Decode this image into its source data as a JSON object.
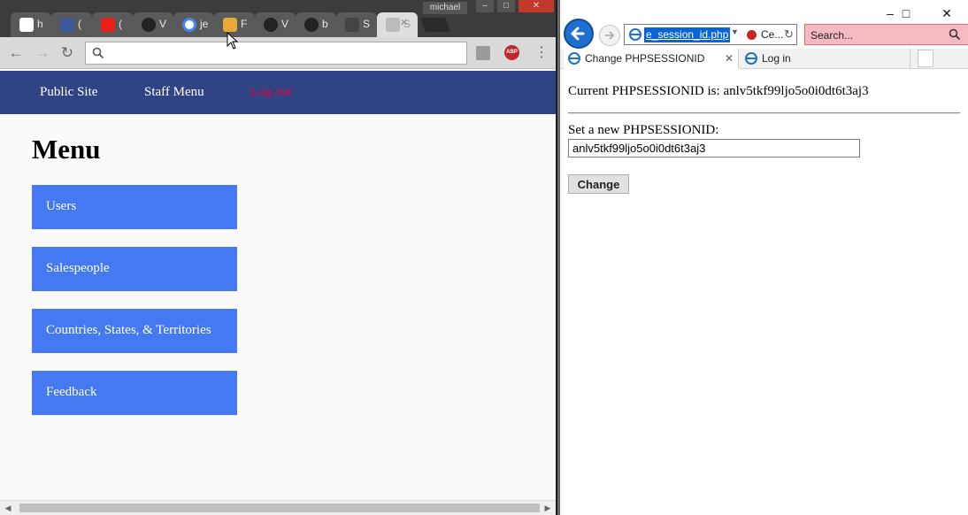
{
  "chrome": {
    "tabs": [
      {
        "title": "h",
        "icon": "c-logo-icon",
        "color": "#ffffff"
      },
      {
        "title": "(",
        "icon": "facebook-icon",
        "color": "#3b5998"
      },
      {
        "title": "(",
        "icon": "youtube-icon",
        "color": "#e62117"
      },
      {
        "title": "V",
        "icon": "github-icon",
        "color": "#222222"
      },
      {
        "title": "je",
        "icon": "google-icon",
        "color": "#ffffff"
      },
      {
        "title": "F",
        "icon": "lightbulb-icon",
        "color": "#e7a83a"
      },
      {
        "title": "V",
        "icon": "github-icon",
        "color": "#222222"
      },
      {
        "title": "b",
        "icon": "github-icon",
        "color": "#222222"
      },
      {
        "title": "S",
        "icon": "blank-page-icon",
        "color": "#444444"
      },
      {
        "title": "S",
        "icon": "blank-page-icon",
        "color": "#bbbbbb",
        "active": true
      }
    ],
    "profile_name": "michael",
    "address_value": "",
    "accent_nav": "#304485",
    "accent_button": "#4479f1",
    "logout_color": "#e8003d"
  },
  "site": {
    "nav": {
      "public_site": "Public Site",
      "staff_menu": "Staff Menu",
      "log_out": "Log out"
    },
    "heading": "Menu",
    "menu_items": [
      "Users",
      "Salespeople",
      "Countries, States, & Territories",
      "Feedback"
    ]
  },
  "ie": {
    "address_url": "e_session_id.php",
    "cert_text": "Ce...",
    "search_placeholder": "Search...",
    "tabs": [
      {
        "label": "Change PHPSESSIONID",
        "active": true
      },
      {
        "label": "Log in",
        "active": false
      }
    ],
    "page": {
      "current_label": "Current PHPSESSIONID is:",
      "current_value": "anlv5tkf99ljo5o0i0dt6t3aj3",
      "set_label": "Set a new PHPSESSIONID:",
      "input_value": "anlv5tkf99ljo5o0i0dt6t3aj3",
      "button_label": "Change"
    }
  }
}
